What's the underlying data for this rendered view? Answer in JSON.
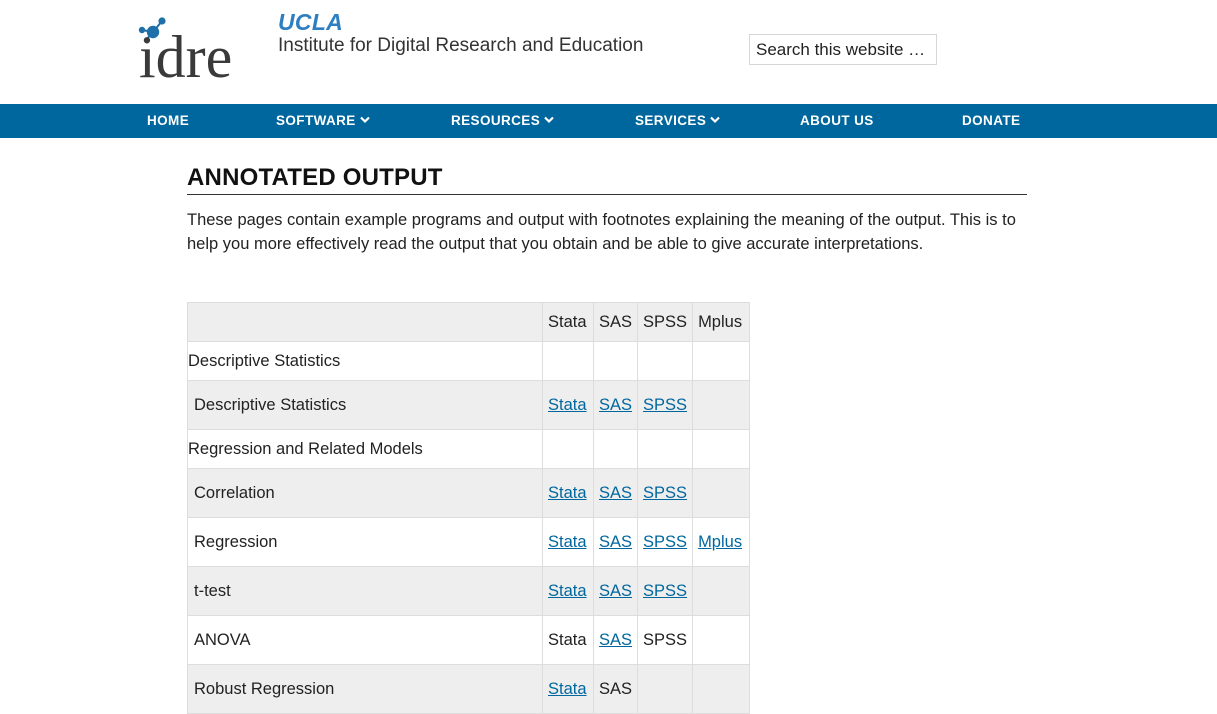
{
  "header": {
    "logo_text": "idre",
    "org": "UCLA",
    "institute": "Institute for Digital Research and Education",
    "search_placeholder": "Search this website …"
  },
  "nav": {
    "items": [
      {
        "label": "HOME",
        "has_dropdown": false
      },
      {
        "label": "SOFTWARE",
        "has_dropdown": true
      },
      {
        "label": "RESOURCES",
        "has_dropdown": true
      },
      {
        "label": "SERVICES",
        "has_dropdown": true
      },
      {
        "label": "ABOUT US",
        "has_dropdown": false
      },
      {
        "label": "DONATE",
        "has_dropdown": false
      }
    ]
  },
  "main": {
    "title": "ANNOTATED OUTPUT",
    "intro": "These pages contain example programs and output with footnotes explaining the meaning of the output. This is to help you more effectively read the output that you obtain and be able to give accurate interpretations."
  },
  "table": {
    "headers": [
      "",
      "Stata",
      "SAS",
      "SPSS",
      "Mplus"
    ],
    "rows": [
      {
        "type": "category",
        "name": "Descriptive Statistics"
      },
      {
        "type": "item",
        "name": "Descriptive Statistics",
        "cells": [
          {
            "text": "Stata",
            "link": true
          },
          {
            "text": "SAS",
            "link": true
          },
          {
            "text": "SPSS",
            "link": true
          },
          {
            "text": "",
            "link": false
          }
        ]
      },
      {
        "type": "category",
        "name": "Regression and Related Models"
      },
      {
        "type": "item",
        "name": "Correlation",
        "cells": [
          {
            "text": "Stata",
            "link": true
          },
          {
            "text": "SAS",
            "link": true
          },
          {
            "text": "SPSS",
            "link": true
          },
          {
            "text": "",
            "link": false
          }
        ]
      },
      {
        "type": "item",
        "name": "Regression",
        "cells": [
          {
            "text": "Stata",
            "link": true
          },
          {
            "text": "SAS",
            "link": true
          },
          {
            "text": "SPSS",
            "link": true
          },
          {
            "text": "Mplus",
            "link": true
          }
        ]
      },
      {
        "type": "item",
        "name": "t-test",
        "cells": [
          {
            "text": "Stata",
            "link": true
          },
          {
            "text": "SAS",
            "link": true
          },
          {
            "text": "SPSS",
            "link": true
          },
          {
            "text": "",
            "link": false
          }
        ]
      },
      {
        "type": "item",
        "name": "ANOVA",
        "cells": [
          {
            "text": "Stata",
            "link": false
          },
          {
            "text": "SAS",
            "link": true
          },
          {
            "text": "SPSS",
            "link": false
          },
          {
            "text": "",
            "link": false
          }
        ]
      },
      {
        "type": "item",
        "name": "Robust Regression",
        "cells": [
          {
            "text": "Stata",
            "link": true
          },
          {
            "text": "SAS",
            "link": false
          },
          {
            "text": "",
            "link": false
          },
          {
            "text": "",
            "link": false
          }
        ]
      }
    ]
  },
  "colors": {
    "nav_bg": "#00679e",
    "link": "#00679e",
    "ucla_blue": "#2d7fc1",
    "row_shade": "#eeeeee"
  },
  "icons": {
    "logo": "idre-molecule-logo",
    "dropdown": "chevron-down-icon"
  }
}
